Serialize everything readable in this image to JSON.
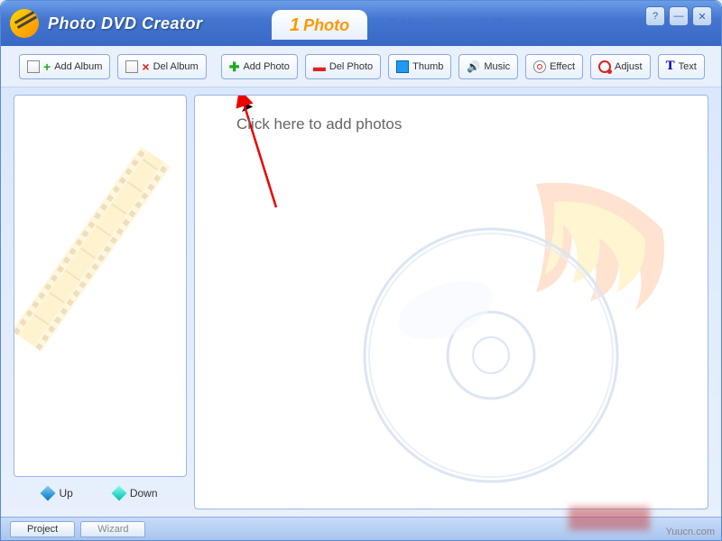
{
  "app_title": "Photo DVD Creator",
  "window_controls": {
    "help": "?",
    "minimize": "—",
    "close": "✕"
  },
  "steps": [
    {
      "num": "1",
      "label": "Photo",
      "active": true
    },
    {
      "num": "2",
      "label": "Menu",
      "active": false
    },
    {
      "num": "3",
      "label": "Burn",
      "active": false
    }
  ],
  "toolbar": {
    "add_album": "Add Album",
    "del_album": "Del Album",
    "add_photo": "Add Photo",
    "del_photo": "Del Photo",
    "thumb": "Thumb",
    "music": "Music",
    "effect": "Effect",
    "adjust": "Adjust",
    "text": "Text"
  },
  "main": {
    "add_prompt": "Click here to add photos"
  },
  "sidebar": {
    "up": "Up",
    "down": "Down"
  },
  "footer": {
    "project": "Project",
    "wizard": "Wizard"
  },
  "watermark": "Yuucn.com"
}
